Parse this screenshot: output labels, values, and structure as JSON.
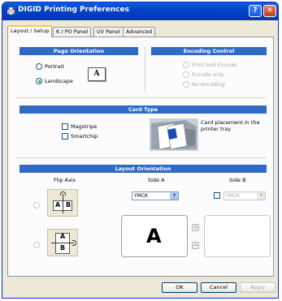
{
  "window": {
    "title": "DIGID Printing Preferences",
    "help_label": "?",
    "close_label": "✕"
  },
  "tabs": [
    "Layout / Setup",
    "K / PO Panel",
    "UV Panel",
    "Advanced"
  ],
  "page_orientation": {
    "header": "Page Orientation",
    "portrait_label": "Portrait",
    "landscape_label": "Landscape",
    "selected": "Landscape",
    "preview_letter": "A"
  },
  "encoding_control": {
    "header": "Encoding Control",
    "options": [
      "Print and Encode",
      "Encode only",
      "No encoding"
    ],
    "selected": "Print and Encode"
  },
  "card_type": {
    "header": "Card Type",
    "magstripe_label": "Magstripe",
    "smartchip_label": "Smartchip",
    "placement_text": "Card placement in the printer tray"
  },
  "layout_orientation": {
    "header": "Layout Orientation",
    "flip_axis_label": "Flip Axis",
    "side_a_label": "Side A",
    "side_b_label": "Side B",
    "side_a_value": "YMCK",
    "side_b_value": "YMCK",
    "flip_vertical": {
      "left": "A",
      "right": "B"
    },
    "flip_horizontal": {
      "top": "A",
      "bottom": "B"
    },
    "preview_letter": "A",
    "rotate_icon": "rotate-icon",
    "swap_icon": "swap-icon"
  },
  "footer": {
    "ok_label": "OK",
    "cancel_label": "Cancel",
    "apply_label": "Apply"
  },
  "colors": {
    "title_bar": "#0442c8",
    "section_bar": "#316ac5",
    "radio_dot": "#21a121",
    "window_bg": "#ece9d8"
  }
}
